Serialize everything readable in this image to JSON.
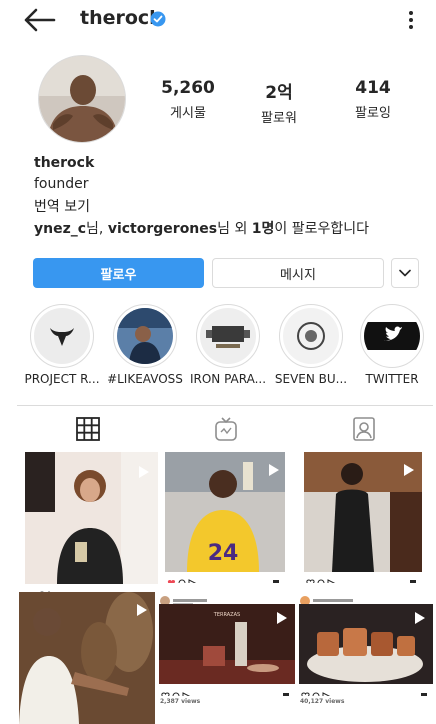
{
  "header": {
    "username": "therock"
  },
  "stats": [
    {
      "value": "5,260",
      "label": "게시물"
    },
    {
      "value": "2억",
      "label": "팔로워"
    },
    {
      "value": "414",
      "label": "팔로잉"
    }
  ],
  "bio": {
    "name": "therock",
    "role": "founder",
    "translate": "번역 보기",
    "followed_users": "ynez_c",
    "followed_suffix1": "님, ",
    "followed_user2": "victorgerones",
    "followed_suffix2": "님 외 ",
    "followed_count": "1명",
    "followed_tail": "이 팔로우합니다"
  },
  "actions": {
    "follow": "팔로우",
    "message": "메시지"
  },
  "highlights": [
    {
      "label": "PROJECT R..."
    },
    {
      "label": "#LIKEAVOSS"
    },
    {
      "label": "IRON PARA..."
    },
    {
      "label": "SEVEN BU..."
    },
    {
      "label": "TWITTER"
    }
  ],
  "posts": {
    "views_1": "40,127 views",
    "views_2": "2,387 views"
  },
  "colors": {
    "accent": "#3897f0",
    "verified": "#3897f0",
    "border": "#dbdbdb"
  }
}
